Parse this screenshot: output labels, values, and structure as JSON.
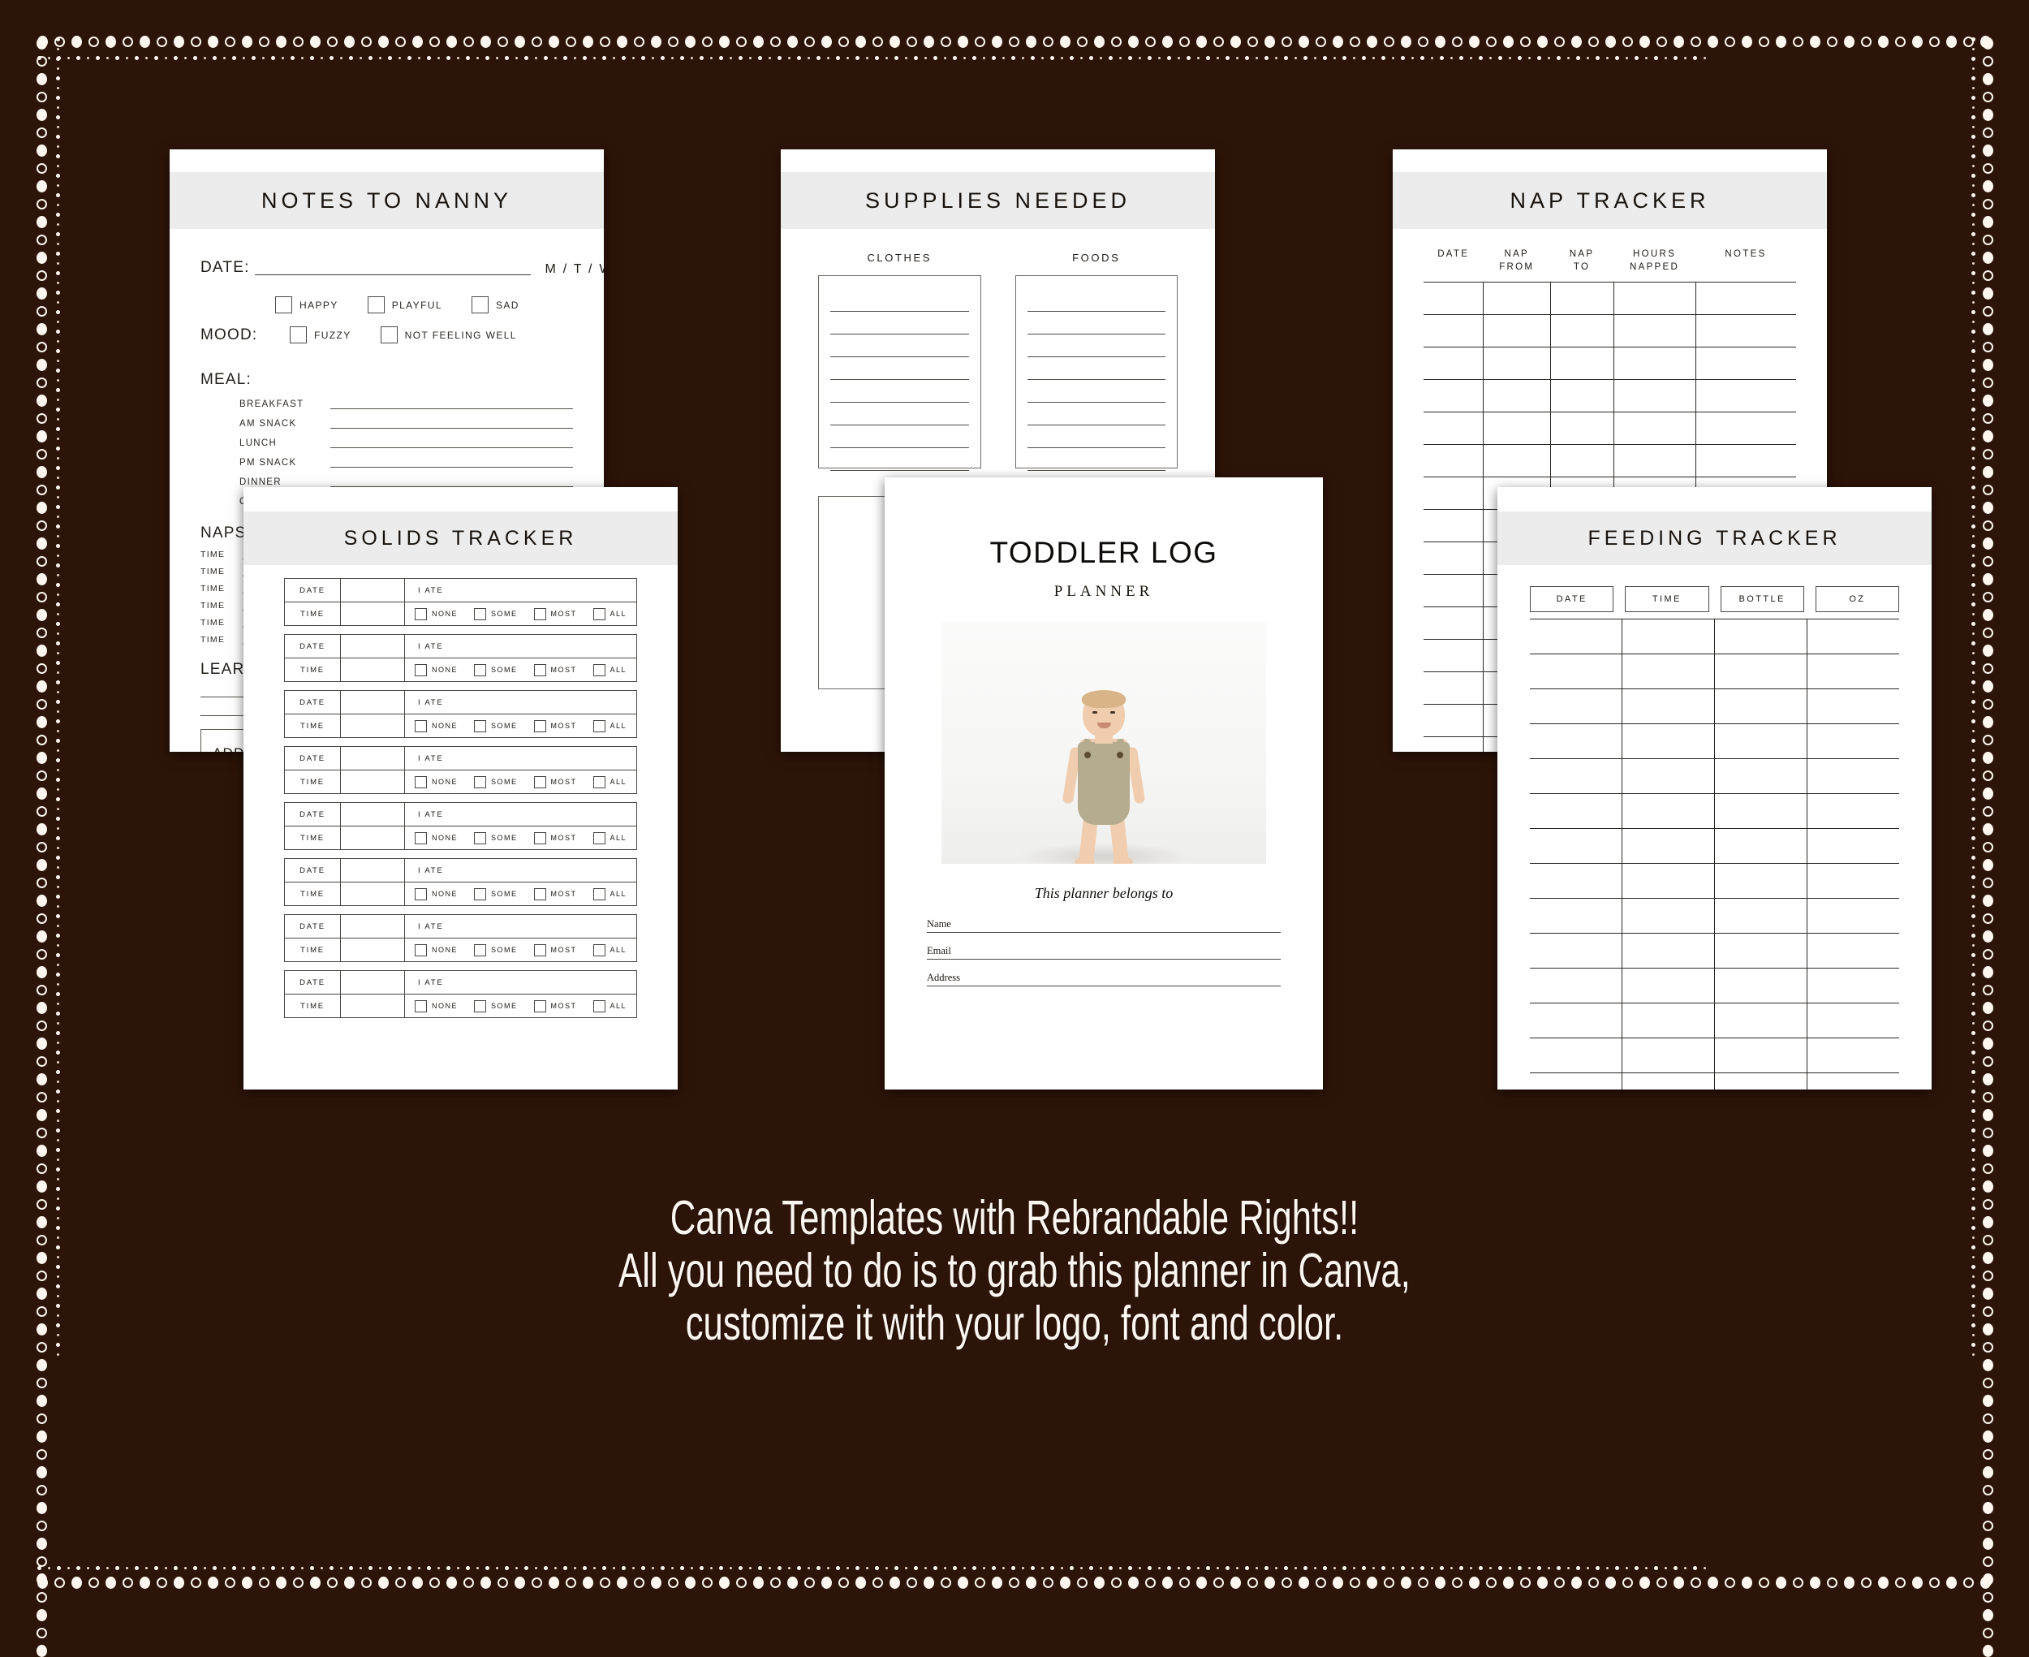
{
  "background_color": "#2d1408",
  "accent_band_color": "#ececec",
  "caption": {
    "line1": "Canva Templates with Rebrandable Rights!!",
    "line2": "All you need to do is to grab this planner in Canva,",
    "line3": "customize it with your logo, font and color."
  },
  "pages": {
    "notes_to_nanny": {
      "title": "NOTES TO NANNY",
      "date_label": "DATE:",
      "days": "M / T / W / TH / F / S / S",
      "mood_label": "MOOD:",
      "mood_options_row1": [
        "HAPPY",
        "PLAYFUL",
        "SAD"
      ],
      "mood_options_row2": [
        "FUZZY",
        "NOT FEELING WELL"
      ],
      "meal_label": "MEAL:",
      "meals": [
        "BREAKFAST",
        "AM SNACK",
        "LUNCH",
        "PM SNACK",
        "DINNER",
        "OTHERS"
      ],
      "naps_label": "NAPS",
      "nap_rows": [
        "TIME",
        "TIME",
        "TIME",
        "TIME",
        "TIME",
        "TIME"
      ],
      "learn_label": "LEARN",
      "additional_label": "ADDITIONAL"
    },
    "supplies_needed": {
      "title": "SUPPLIES NEEDED",
      "columns": [
        "CLOTHES",
        "FOODS"
      ],
      "lines_per_box": 8
    },
    "nap_tracker": {
      "title": "NAP TRACKER",
      "columns": [
        "DATE",
        "NAP\nFROM",
        "NAP\nTO",
        "HOURS\nNAPPED",
        "NOTES"
      ],
      "column_labels": [
        {
          "l1": "DATE",
          "l2": ""
        },
        {
          "l1": "NAP",
          "l2": "FROM"
        },
        {
          "l1": "NAP",
          "l2": "TO"
        },
        {
          "l1": "HOURS",
          "l2": "NAPPED"
        },
        {
          "l1": "NOTES",
          "l2": ""
        }
      ],
      "row_count": 16
    },
    "solids_tracker": {
      "title": "SOLIDS  TRACKER",
      "date_label": "DATE",
      "time_label": "TIME",
      "ate_label": "I ATE",
      "amount_options": [
        "NONE",
        "SOME",
        "MOST",
        "ALL"
      ],
      "block_count": 8
    },
    "toddler_log": {
      "title": "TODDLER LOG",
      "subtitle": "PLANNER",
      "photo_alt": "toddler-standing-photo",
      "belongs_to": "This planner belongs to",
      "fields": [
        "Name",
        "Email",
        "Address"
      ]
    },
    "feeding_tracker": {
      "title": "FEEDING TRACKER",
      "columns": [
        "DATE",
        "TIME",
        "BOTTLE",
        "OZ"
      ],
      "row_count": 15
    }
  }
}
